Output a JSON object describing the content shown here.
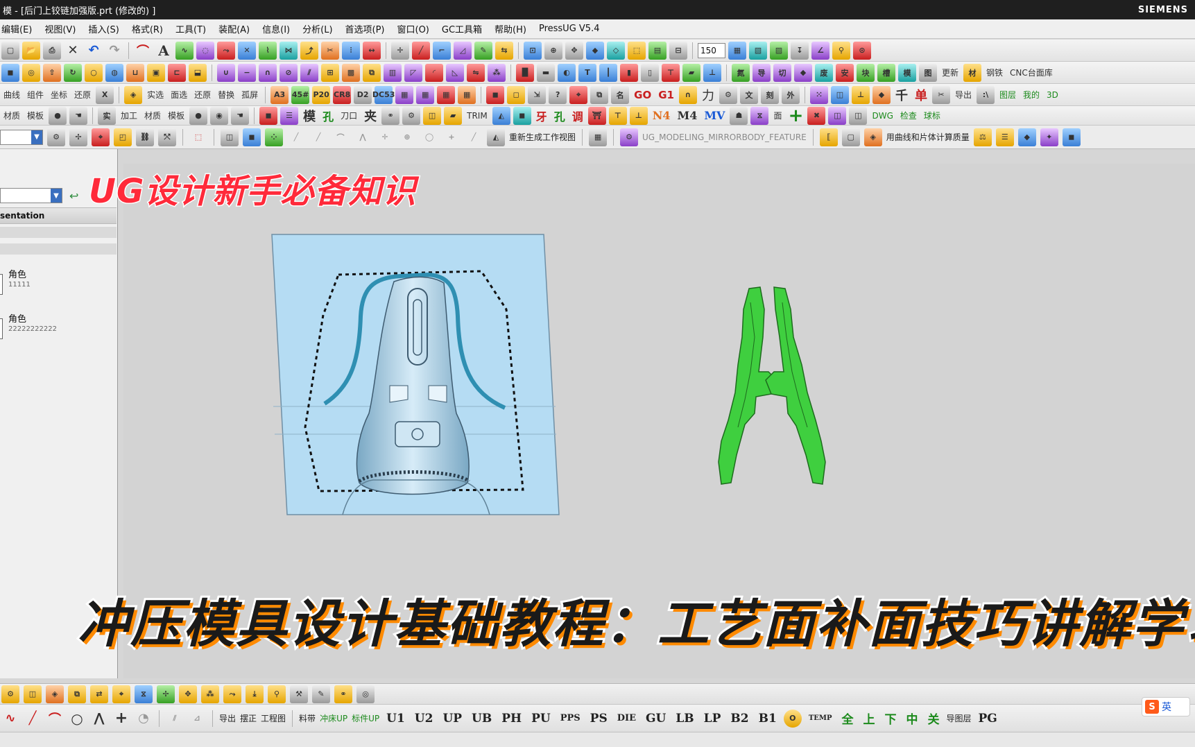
{
  "window": {
    "title": "模 - [后门上铰链加强版.prt  (修改的)  ]",
    "brand": "SIEMENS"
  },
  "menu": {
    "items": [
      "编辑(E)",
      "视图(V)",
      "插入(S)",
      "格式(R)",
      "工具(T)",
      "装配(A)",
      "信息(I)",
      "分析(L)",
      "首选项(P)",
      "窗口(O)",
      "GC工具箱",
      "帮助(H)",
      "PressUG V5.4"
    ]
  },
  "toolbar": {
    "zoom_value": "150",
    "row3_labels": [
      "曲线",
      "组件",
      "坐标",
      "还原"
    ],
    "row3_btn_labels": [
      "实选",
      "面选",
      "还原",
      "替换",
      "孤屏",
      "A3",
      "45#",
      "P20",
      "CR8",
      "D2",
      "DC53",
      "GO",
      "G1",
      "力",
      "千",
      "单",
      "导出"
    ],
    "row4_labels": [
      "材质",
      "模板",
      "加工",
      "材质",
      "模板",
      "模",
      "孔",
      "刀口",
      "夹",
      "TRIM",
      "牙",
      "孔",
      "调",
      "N4",
      "M4",
      "MV",
      "面"
    ],
    "row2_right_label": "CNC台面库",
    "row2_right_labels": [
      "更新",
      "钢铁"
    ],
    "row4_right_labels": [
      "DWG",
      "检查",
      "球标"
    ],
    "row3_right_labels": [
      "图层",
      "我的",
      "3D"
    ]
  },
  "selection_bar": {
    "regen_label": "重新生成工作视图",
    "feature_label": "UG_MODELING_MIRRORBODY_FEATURE",
    "mass_label": "用曲线和片体计算质量"
  },
  "left_panel": {
    "header": "sentation",
    "roles": [
      {
        "name": "角色",
        "value": "11111"
      },
      {
        "name": "角色",
        "value": "22222222222"
      }
    ]
  },
  "overlay": {
    "top_text": "UG设计新手必备知识",
    "bottom_text": "冲压模具设计基础教程：工艺面补面技巧讲解学习"
  },
  "bottom_toolbar": {
    "row2_labels": [
      "导出",
      "摆正",
      "工程图",
      "料带",
      "冲床UP",
      "标件UP"
    ],
    "codes": [
      "U1",
      "U2",
      "UP",
      "UB",
      "PH",
      "PU",
      "PPS",
      "PS",
      "DIE",
      "GU",
      "LB",
      "LP",
      "B2",
      "B1"
    ],
    "special": [
      "TEMP",
      "全",
      "上",
      "下",
      "中",
      "关",
      "导图层",
      "PG"
    ]
  },
  "ime": {
    "brand_letter": "S",
    "language": "英"
  },
  "colors": {
    "part_blue": "#b5dcf3",
    "part_green": "#3fcf3f",
    "title_red": "#ff2a3a",
    "subtitle_shadow": "#ff8a00"
  }
}
